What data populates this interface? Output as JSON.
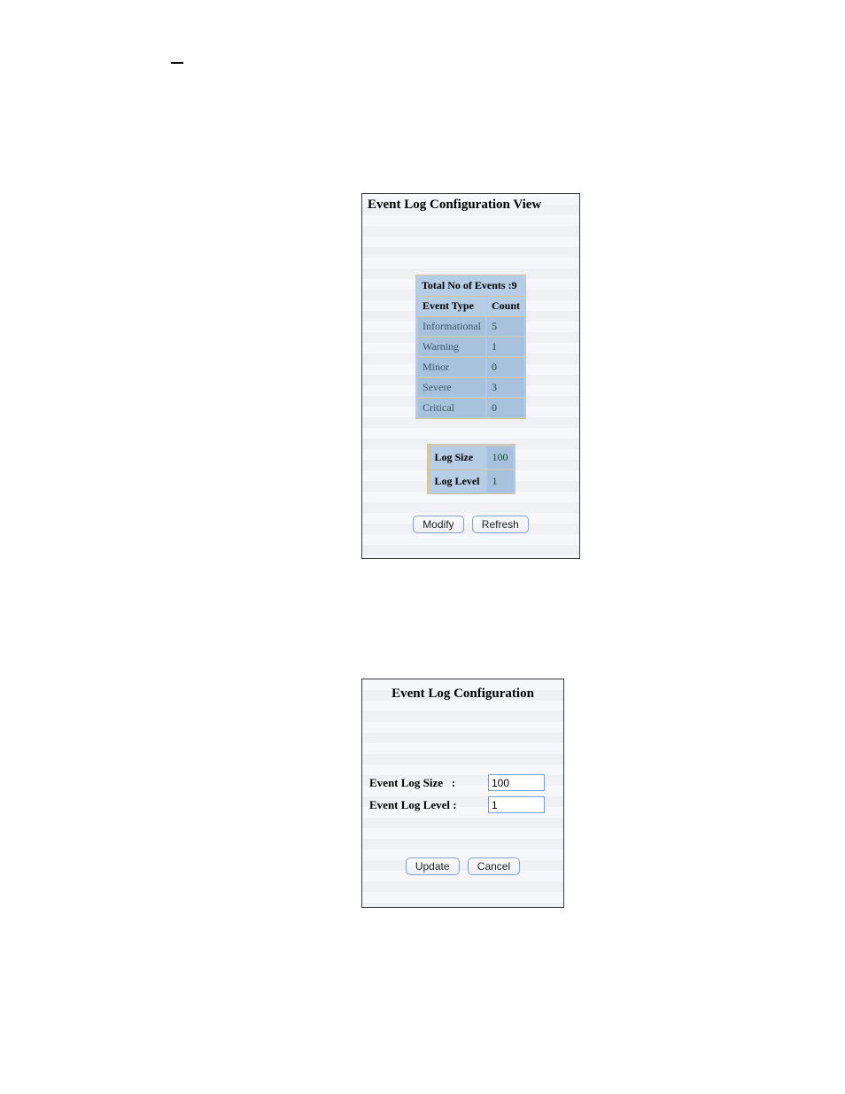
{
  "view": {
    "title": "Event Log Configuration View",
    "total_caption": "Total No of Events :9",
    "headers": {
      "type": "Event Type",
      "count": "Count"
    },
    "rows": [
      {
        "type": "Informational",
        "count": "5"
      },
      {
        "type": "Warning",
        "count": "1"
      },
      {
        "type": "Minor",
        "count": "0"
      },
      {
        "type": "Severe",
        "count": "3"
      },
      {
        "type": "Critical",
        "count": "0"
      }
    ],
    "config": {
      "log_size_label": "Log Size",
      "log_size_value": "100",
      "log_level_label": "Log Level",
      "log_level_value": "1"
    },
    "buttons": {
      "modify": "Modify",
      "refresh": "Refresh"
    }
  },
  "edit": {
    "title": "Event Log Configuration",
    "log_size_label": "Event Log Size",
    "log_level_label": "Event Log Level :",
    "log_size_value": "100",
    "log_level_value": "1",
    "buttons": {
      "update": "Update",
      "cancel": "Cancel"
    }
  }
}
